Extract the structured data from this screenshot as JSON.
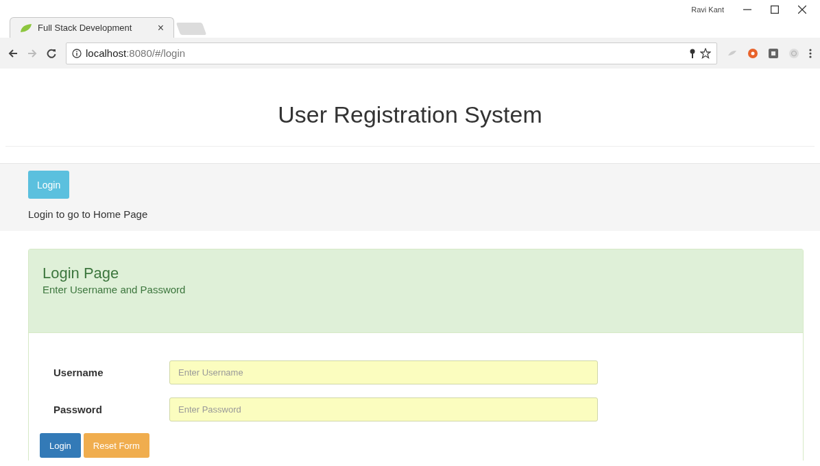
{
  "browser": {
    "tab": {
      "title": "Full Stack Development",
      "close": "×"
    },
    "profile": "Ravi Kant",
    "url": {
      "host": "localhost",
      "path": ":8080/#/login"
    }
  },
  "page": {
    "title": "User Registration System",
    "banner": {
      "button": "Login",
      "text": "Login to go to Home Page"
    },
    "panel": {
      "title": "Login Page",
      "subtitle": "Enter Username and Password",
      "fields": [
        {
          "label": "Username",
          "placeholder": "Enter Username"
        },
        {
          "label": "Password",
          "placeholder": "Enter Password"
        }
      ],
      "buttons": [
        {
          "label": "Login",
          "kind": "primary"
        },
        {
          "label": "Reset Form",
          "kind": "warning"
        }
      ]
    }
  }
}
